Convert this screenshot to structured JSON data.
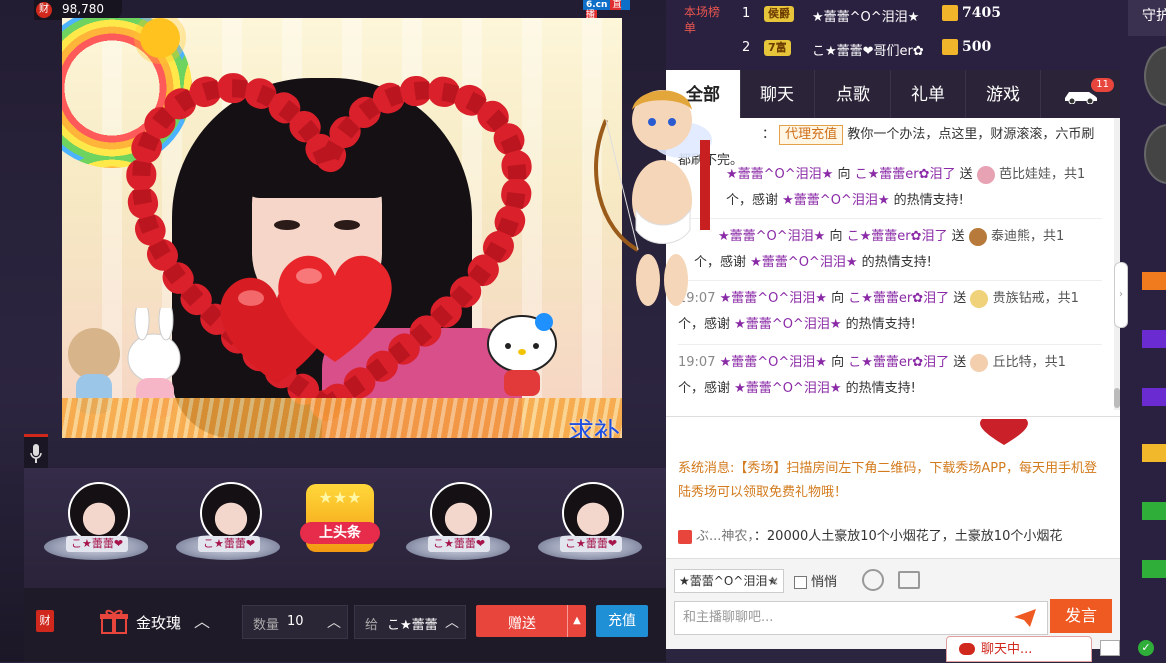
{
  "header": {
    "wealth_icon": "财",
    "wealth_value": "98,780",
    "site_logo": "6.cn",
    "live_label": "直播"
  },
  "video": {
    "watermark": "求补刀"
  },
  "gift_slots": [
    {
      "name": "こ★蕾蕾❤"
    },
    {
      "name": "こ★蕾蕾❤"
    },
    {
      "headline": "上头条"
    },
    {
      "name": "こ★蕾蕾❤"
    },
    {
      "name": "こ★蕾蕾❤"
    }
  ],
  "bottom_bar": {
    "wealth_icon": "财",
    "gift_name": "金玫瑰",
    "quantity_label": "数量",
    "quantity_value": "10",
    "to_label": "给",
    "to_value": "こ★蕾蕾",
    "send_label": "赠送",
    "recharge_label": "充值"
  },
  "ranking": {
    "label": "本场榜单",
    "rows": [
      {
        "rank": "1",
        "level": "侯爵",
        "name": "★蕾蕾^O^泪泪★",
        "score": "7405"
      },
      {
        "rank": "2",
        "level": "7富",
        "name": "こ★蕾蕾❤哥们er✿",
        "score": "500"
      }
    ]
  },
  "tabs": [
    {
      "label": "全部"
    },
    {
      "label": "聊天"
    },
    {
      "label": "点歌"
    },
    {
      "label": "礼单"
    },
    {
      "label": "游戏"
    }
  ],
  "car_badge": "11",
  "messages": [
    {
      "prefix": "：",
      "tag": "代理充值",
      "text": "教你一个办法，点这里，财源滚滚，六币刷都刷不完。"
    },
    {
      "from": "★蕾蕾^O^泪泪★",
      "to_label": "向",
      "to": "こ★蕾蕾er✿泪了",
      "send": "送",
      "gift": "芭比娃娃，共1",
      "thanks_pre": "个，感谢",
      "thanks_name": "★蕾蕾^O^泪泪★",
      "thanks_post": "的热情支持!"
    },
    {
      "from": "★蕾蕾^O^泪泪★",
      "to_label": "向",
      "to": "こ★蕾蕾er✿泪了",
      "send": "送",
      "gift": "泰迪熊，共1",
      "thanks_pre": "个，感谢",
      "thanks_name": "★蕾蕾^O^泪泪★",
      "thanks_post": "的热情支持!"
    },
    {
      "time": "19:07",
      "from": "★蕾蕾^O^泪泪★",
      "to_label": "向",
      "to": "こ★蕾蕾er✿泪了",
      "send": "送",
      "gift": "贵族钻戒，共1",
      "thanks_pre": "个，感谢",
      "thanks_name": "★蕾蕾^O^泪泪★",
      "thanks_post": "的热情支持!"
    },
    {
      "time": "19:07",
      "from": "★蕾蕾^O^泪泪★",
      "to_label": "向",
      "to": "こ★蕾蕾er✿泪了",
      "send": "送",
      "gift": "丘比特，共1",
      "thanks_pre": "个，感谢",
      "thanks_name": "★蕾蕾^O^泪泪★",
      "thanks_post": "的热情支持!"
    }
  ],
  "system": {
    "message": "系统消息:【秀场】扫描房间左下角二维码，下载秀场APP，每天用手机登陆秀场可以领取免费礼物哦！",
    "scroll_user": "ぶ...神农，",
    "scroll_text": "：20000人土豪放10个小烟花了，土豪放10个小烟花"
  },
  "input": {
    "target": "★蕾蕾^O^泪泪★",
    "whisper_label": "悄悄",
    "placeholder": "和主播聊聊吧...",
    "speak_label": "发言"
  },
  "far_right": {
    "guard_label": "守护"
  },
  "status": {
    "chatting_label": "聊天中..."
  }
}
